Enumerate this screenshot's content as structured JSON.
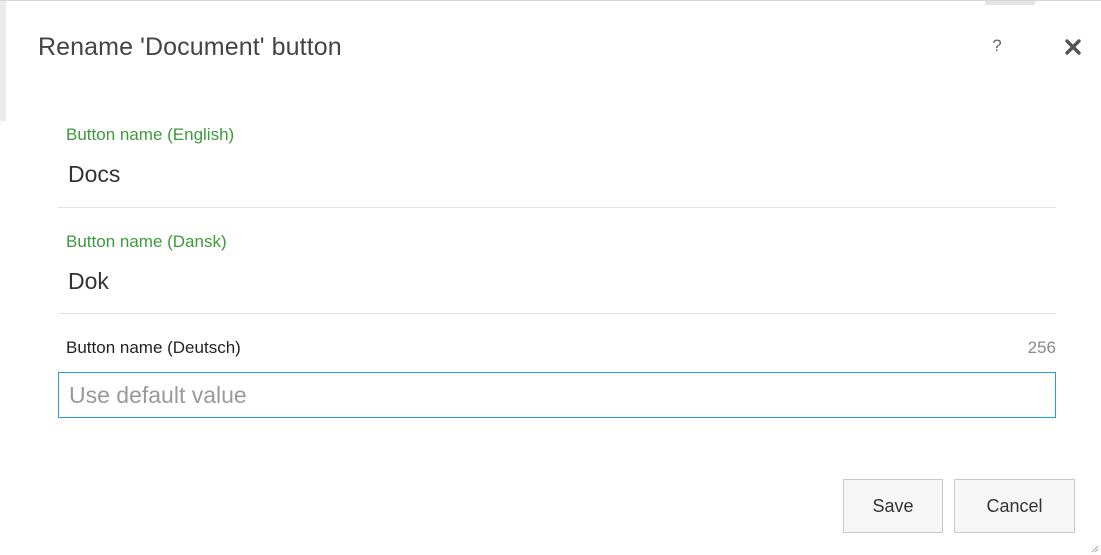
{
  "dialog": {
    "title": "Rename 'Document' button",
    "help_label": "?",
    "close_icon": "close-x-icon"
  },
  "fields": [
    {
      "label": "Button name (English)",
      "value": "Docs",
      "label_color": "#3c9a3c"
    },
    {
      "label": "Button name (Dansk)",
      "value": "Dok",
      "label_color": "#3c9a3c"
    },
    {
      "label": "Button name (Deutsch)",
      "value": "",
      "placeholder": "Use default value",
      "char_count": "256",
      "focus_color": "#2b9ad6"
    }
  ],
  "actions": {
    "save_label": "Save",
    "cancel_label": "Cancel"
  }
}
